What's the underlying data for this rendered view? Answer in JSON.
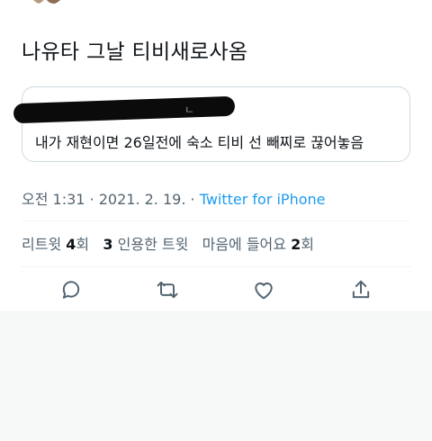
{
  "tweet": {
    "text": "나유타 그날 티비새로사옴"
  },
  "quote": {
    "header_tail": "ㄴ",
    "text": "내가 재현이면 26일전에 숙소 티비 선 빼찌로 끊어놓음"
  },
  "meta": {
    "time": "오전 1:31",
    "sep1": " · ",
    "date": "2021. 2. 19.",
    "sep2": " · ",
    "source": "Twitter for iPhone"
  },
  "stats": {
    "retweets_label": "리트윗",
    "retweets_count": "4",
    "retweets_unit": "회",
    "quotes_count": "3",
    "quotes_label": "인용한 트윗",
    "likes_label": "마음에 들어요",
    "likes_count": "2",
    "likes_unit": "회"
  },
  "icons": {
    "reply": "reply-icon",
    "retweet": "retweet-icon",
    "like": "heart-icon",
    "share": "share-icon"
  }
}
